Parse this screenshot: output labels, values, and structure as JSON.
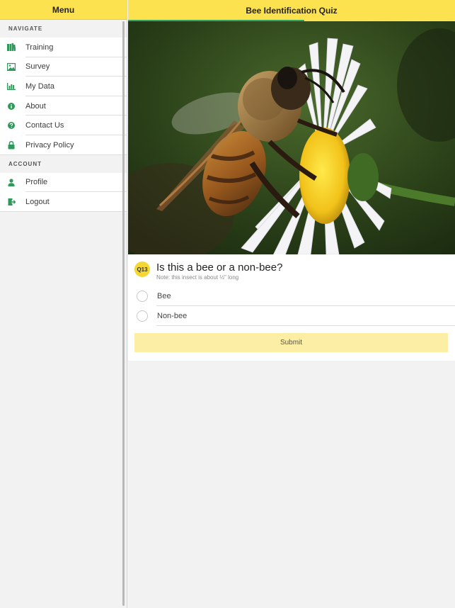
{
  "sidebar": {
    "title": "Menu",
    "sections": [
      {
        "label": "NAVIGATE",
        "items": [
          {
            "label": "Training",
            "icon": "books-icon"
          },
          {
            "label": "Survey",
            "icon": "image-icon"
          },
          {
            "label": "My Data",
            "icon": "bar-chart-icon"
          },
          {
            "label": "About",
            "icon": "info-icon"
          },
          {
            "label": "Contact Us",
            "icon": "help-icon"
          },
          {
            "label": "Privacy Policy",
            "icon": "lock-icon"
          }
        ]
      },
      {
        "label": "ACCOUNT",
        "items": [
          {
            "label": "Profile",
            "icon": "person-icon"
          },
          {
            "label": "Logout",
            "icon": "logout-icon"
          }
        ]
      }
    ]
  },
  "header": {
    "title": "Bee Identification Quiz",
    "progress": 0.54
  },
  "quiz": {
    "number": "Q13",
    "question": "Is this a bee or a non-bee?",
    "note": "Note: this insect is about ½\" long",
    "options": [
      "Bee",
      "Non-bee"
    ],
    "submit_label": "Submit"
  },
  "colors": {
    "brand_yellow": "#fde24f",
    "icon_green": "#2e9a5a",
    "submit_bg": "#fdeea6",
    "progress_green": "#34a463"
  }
}
